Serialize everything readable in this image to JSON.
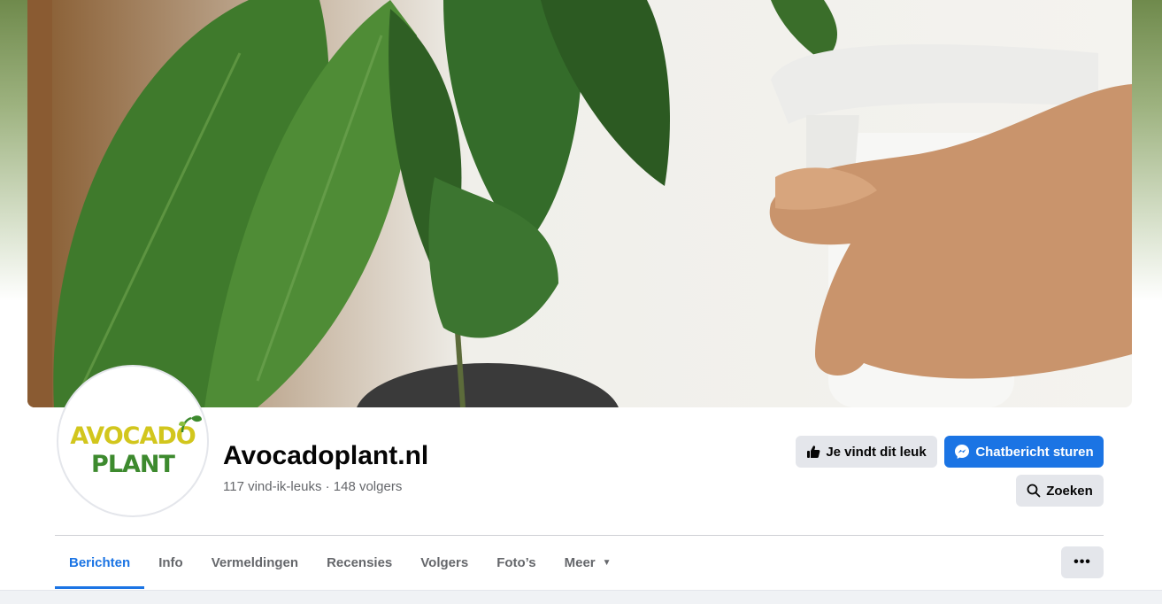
{
  "page": {
    "name": "Avocadoplant.nl",
    "stats": "117 vind-ik-leuks · 148 volgers"
  },
  "logo": {
    "line1": "AVOCADO",
    "line2": "PLANT"
  },
  "actions": {
    "like_label": "Je vindt dit leuk",
    "message_label": "Chatbericht sturen",
    "search_label": "Zoeken",
    "more_label": "•••"
  },
  "tabs": [
    {
      "label": "Berichten",
      "active": true
    },
    {
      "label": "Info",
      "active": false
    },
    {
      "label": "Vermeldingen",
      "active": false
    },
    {
      "label": "Recensies",
      "active": false
    },
    {
      "label": "Volgers",
      "active": false
    },
    {
      "label": "Foto’s",
      "active": false
    },
    {
      "label": "Meer",
      "active": false
    }
  ],
  "colors": {
    "accent": "#1b74e4",
    "secondary_button": "#e4e6eb",
    "muted_text": "#65676b",
    "logo_yellow": "#d2c61d",
    "logo_green": "#3d8a2e"
  },
  "icons": {
    "like": "thumbs-up-icon",
    "message": "messenger-icon",
    "search": "search-icon",
    "caret": "caret-down-icon",
    "more": "more-dots-icon"
  }
}
